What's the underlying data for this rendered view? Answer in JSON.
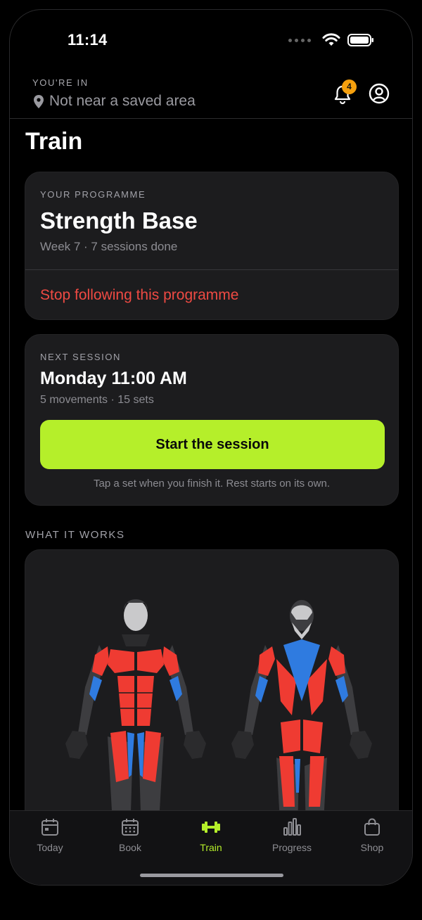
{
  "status_bar": {
    "time": "11:14"
  },
  "location": {
    "label": "YOU'RE IN",
    "value": "Not near a saved area"
  },
  "notifications": {
    "count": "4"
  },
  "page": {
    "title": "Train"
  },
  "programme": {
    "eyebrow": "YOUR PROGRAMME",
    "name": "Strength Base",
    "progress": "Week 7 · 7 sessions done",
    "stop_label": "Stop following this programme"
  },
  "next_session": {
    "eyebrow": "NEXT SESSION",
    "when": "Monday 11:00 AM",
    "summary": "5 movements · 15 sets",
    "start_label": "Start the session",
    "hint": "Tap a set when you finish it. Rest starts on its own."
  },
  "muscles": {
    "label": "WHAT IT WORKS"
  },
  "tabs": [
    {
      "label": "Today",
      "icon": "calendar-icon"
    },
    {
      "label": "Book",
      "icon": "calendar-grid-icon"
    },
    {
      "label": "Train",
      "icon": "dumbbell-icon"
    },
    {
      "label": "Progress",
      "icon": "bar-chart-icon"
    },
    {
      "label": "Shop",
      "icon": "bag-icon"
    }
  ],
  "colors": {
    "accent": "#b5ef2a",
    "danger": "#ef4a43",
    "badge": "#f5a00e",
    "card": "#1c1c1e",
    "muscle_primary": "#ef3b32",
    "muscle_secondary": "#2f7be0"
  }
}
